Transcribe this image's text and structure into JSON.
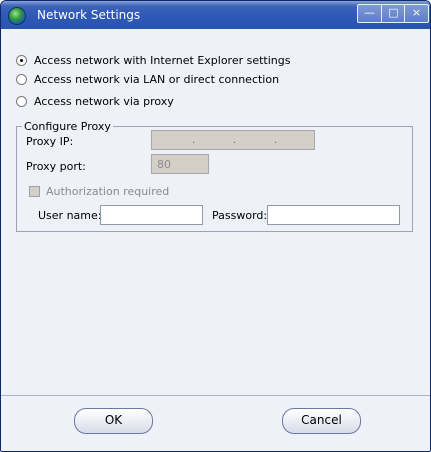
{
  "window": {
    "title": "Network Settings",
    "controls": {
      "minimize": "—",
      "maximize": "□",
      "close": "×"
    }
  },
  "network": {
    "options": [
      {
        "label": "Access network with Internet Explorer settings",
        "checked": true
      },
      {
        "label": "Access network via LAN or direct connection",
        "checked": false
      },
      {
        "label": "Access network via proxy",
        "checked": false
      }
    ]
  },
  "proxy": {
    "group_label": "Configure Proxy",
    "ip_label": "Proxy IP:",
    "ip_dots": [
      ".",
      ".",
      "."
    ],
    "port_label": "Proxy port:",
    "port_value": "80",
    "auth_label": "Authorization required",
    "auth_checked": false,
    "username_label": "User name:",
    "username_value": "",
    "password_label": "Password:",
    "password_value": ""
  },
  "buttons": {
    "ok": "OK",
    "cancel": "Cancel"
  }
}
